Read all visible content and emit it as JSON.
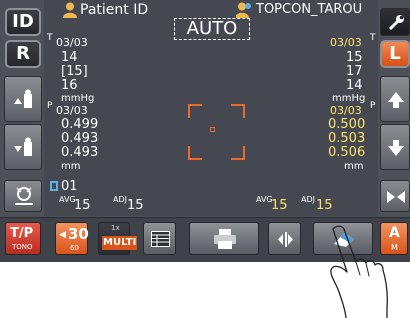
{
  "header": {
    "id_button": "ID",
    "patient_label": "Patient ID",
    "patient_name": "TOPCON_TAROU",
    "mode": "AUTO"
  },
  "left_eye": {
    "side_key": "R"
  },
  "right_eye": {
    "side_key": "L"
  },
  "tono_left": {
    "t_marker": "T",
    "count": "03/03",
    "readings": [
      "14",
      "[15]",
      "16"
    ],
    "unit": "mmHg"
  },
  "tono_right": {
    "t_marker": "T",
    "count": "03/03",
    "readings": [
      "15",
      "17",
      "14"
    ],
    "unit": "mmHg"
  },
  "pachy_left": {
    "p_marker": "P",
    "count": "03/03",
    "readings": [
      "0.499",
      "0.493",
      "0.493"
    ],
    "unit": "mm"
  },
  "pachy_right": {
    "p_marker": "P",
    "count": "03/03",
    "readings": [
      "0.500",
      "0.503",
      "0.506"
    ],
    "unit": "mm"
  },
  "record_no": "01",
  "footer_left": {
    "avg_label": "AVG",
    "avg_value": "15",
    "adj_label": "ADJ",
    "adj_value": "15"
  },
  "footer_right": {
    "avg_label": "AVG",
    "avg_value": "15",
    "adj_label": "ADJ",
    "adj_value": "15"
  },
  "toolbar": {
    "tp_label": "T/P",
    "tp_sub": "TONO",
    "thirty_label": "30",
    "thirty_sub": "60",
    "multi_top": "1x",
    "multi_label": "MULTI",
    "a_label": "A",
    "a_sub": "M"
  },
  "colors": {
    "highlight_yellow": "#ffe36b",
    "accent_orange": "#e86a2c",
    "screen_bg": "#454851"
  },
  "icons": {
    "patient": "person-icon",
    "printer": "printer-icon",
    "eraser": "eraser-icon",
    "wrench": "wrench-icon",
    "pointer": "pointing-hand-icon"
  }
}
